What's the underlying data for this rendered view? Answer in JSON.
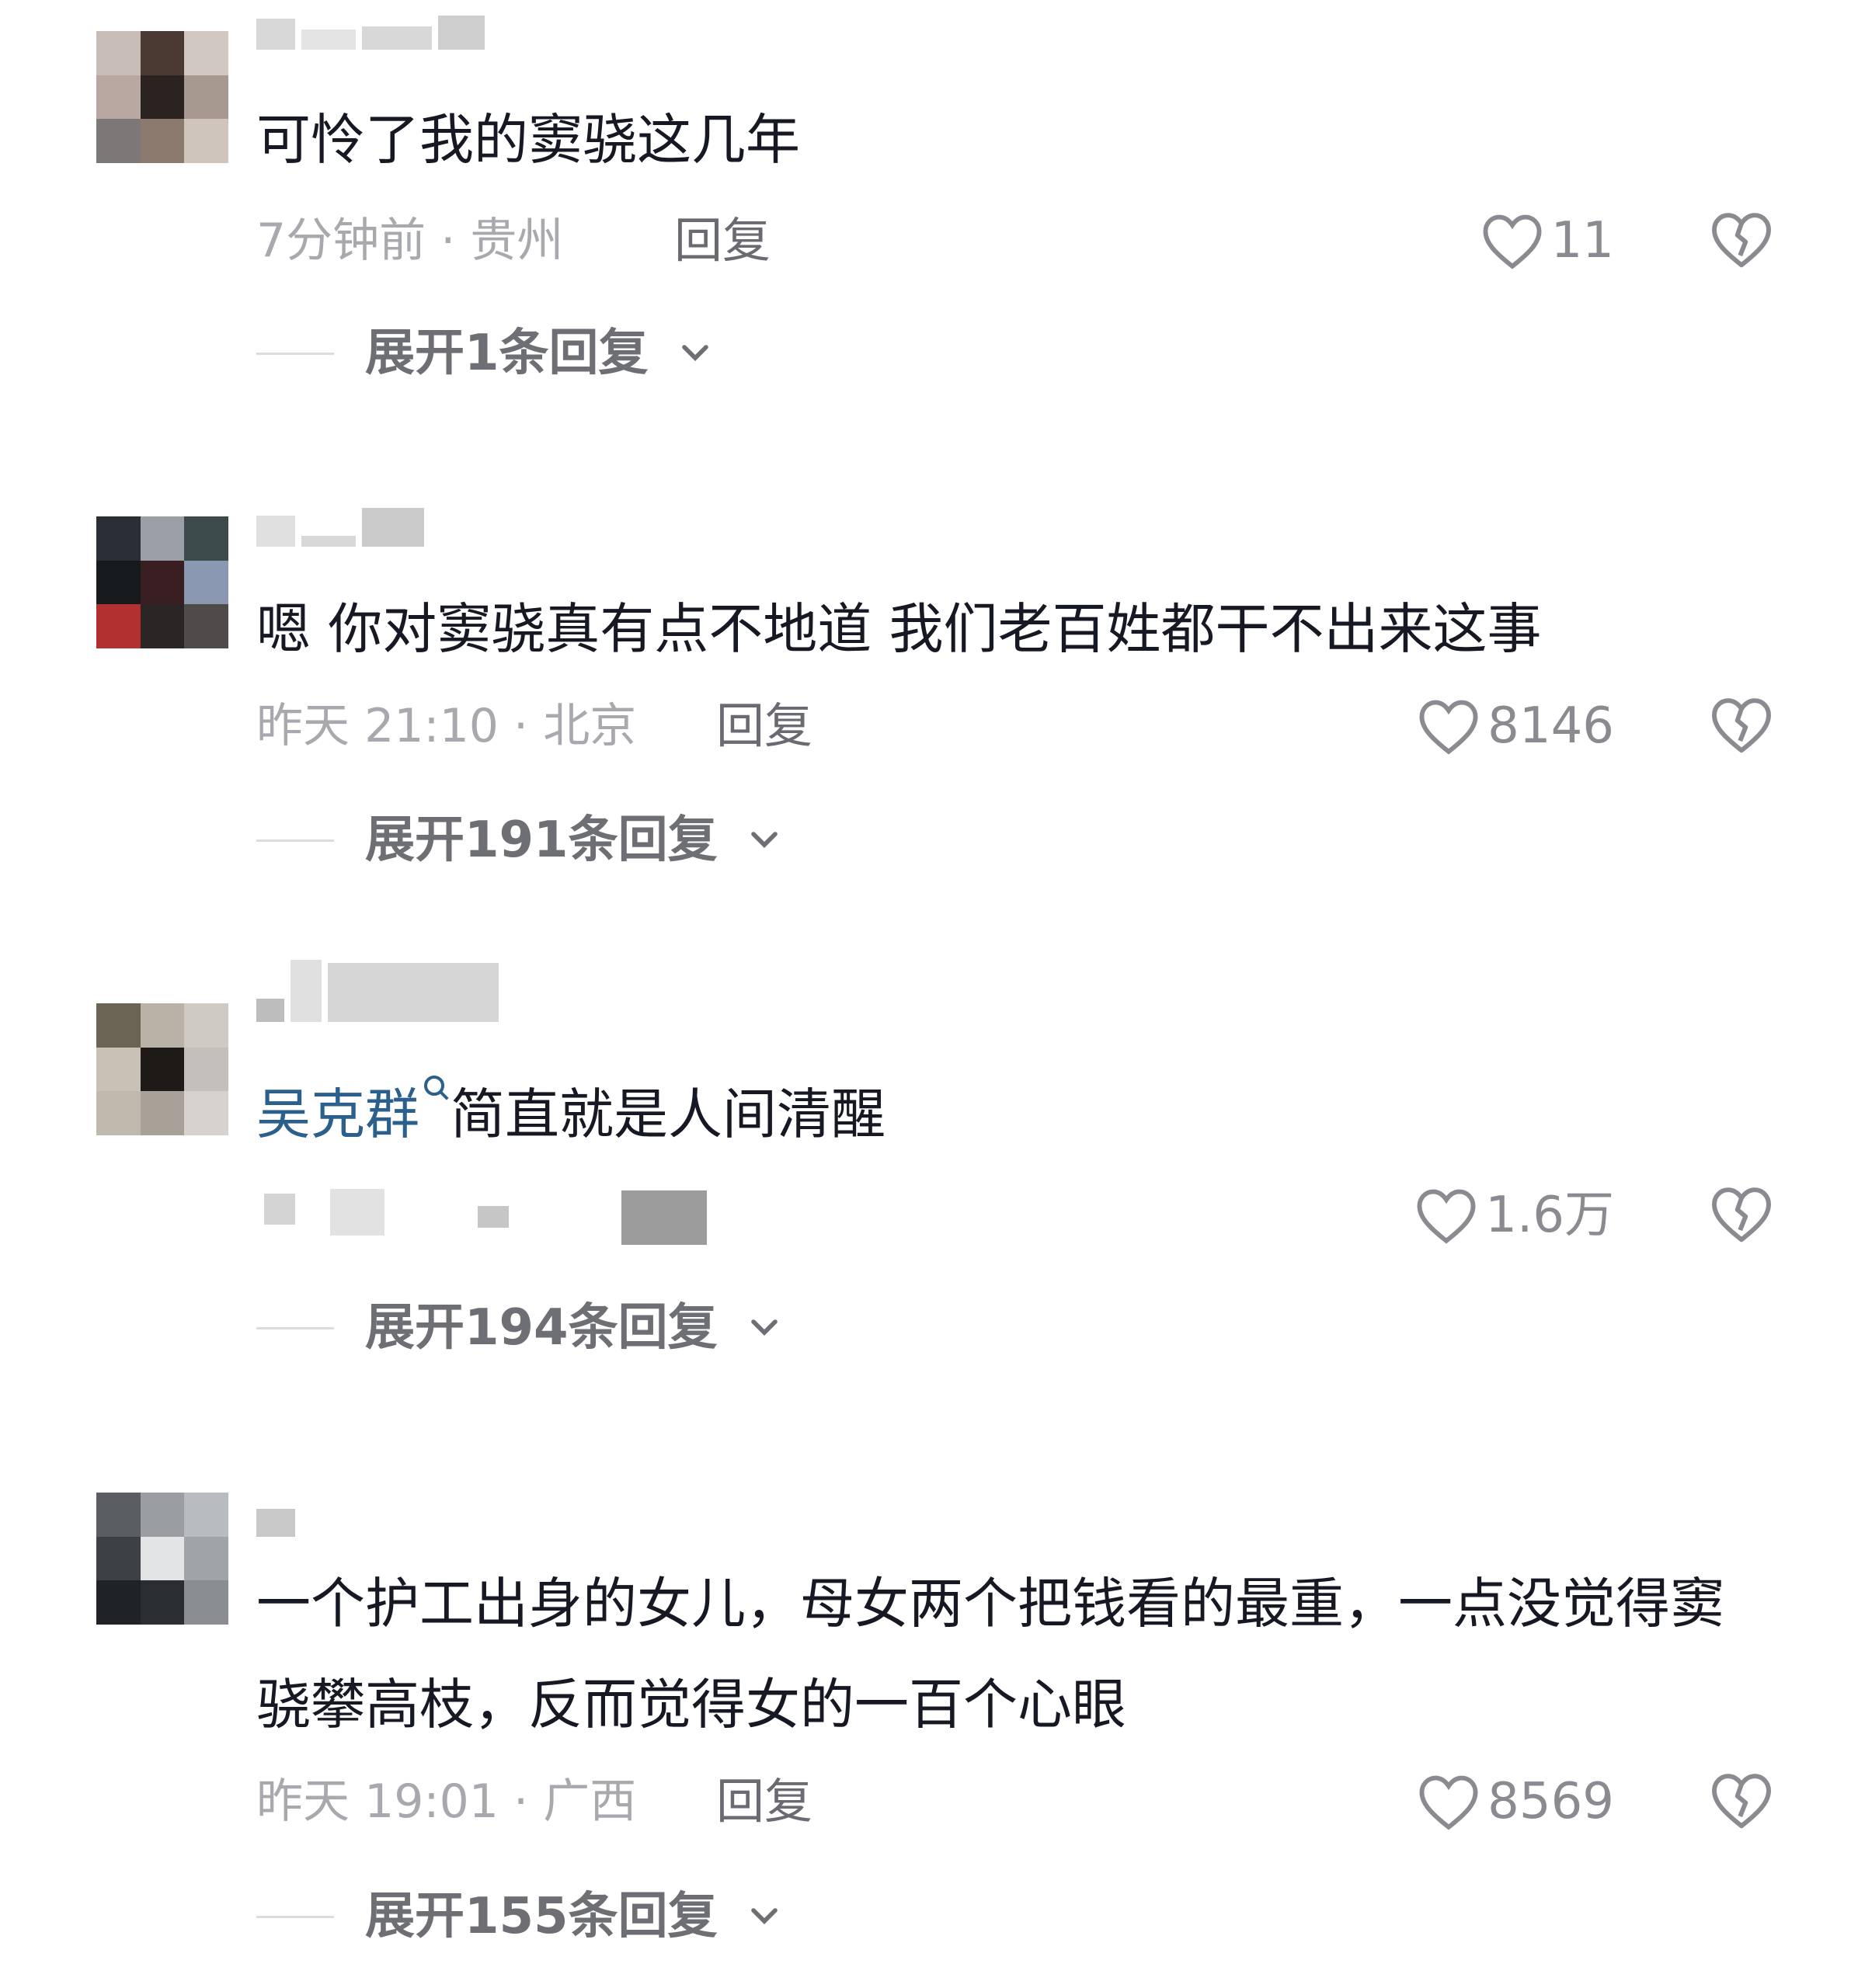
{
  "comments": [
    {
      "text": "可怜了我的窦骁这几年",
      "time_location": "7分钟前 · 贵州",
      "reply_label": "回复",
      "likes": "11",
      "expand_label": "展开1条回复"
    },
    {
      "text": "嗯 你对窦骁真有点不地道 我们老百姓都干不出来这事",
      "time_location": "昨天 21:10 · 北京",
      "reply_label": "回复",
      "likes": "8146",
      "expand_label": "展开191条回复"
    },
    {
      "mention": "吴克群",
      "text": "简直就是人间清醒",
      "likes": "1.6万",
      "expand_label": "展开194条回复"
    },
    {
      "text": "一个护工出身的女儿，母女两个把钱看的最重，一点没觉得窦骁攀高枝，反而觉得女的一百个心眼",
      "time_location": "昨天 19:01 · 广西",
      "reply_label": "回复",
      "likes": "8569",
      "expand_label": "展开155条回复"
    }
  ],
  "icons": {
    "like": "heart-outline-icon",
    "dislike": "broken-heart-icon",
    "expand": "chevron-down-icon",
    "mention": "search-icon"
  },
  "colors": {
    "text": "#161823",
    "meta": "#a8a9ae",
    "mention": "#2b5f8c",
    "expand": "#6e6f75"
  }
}
